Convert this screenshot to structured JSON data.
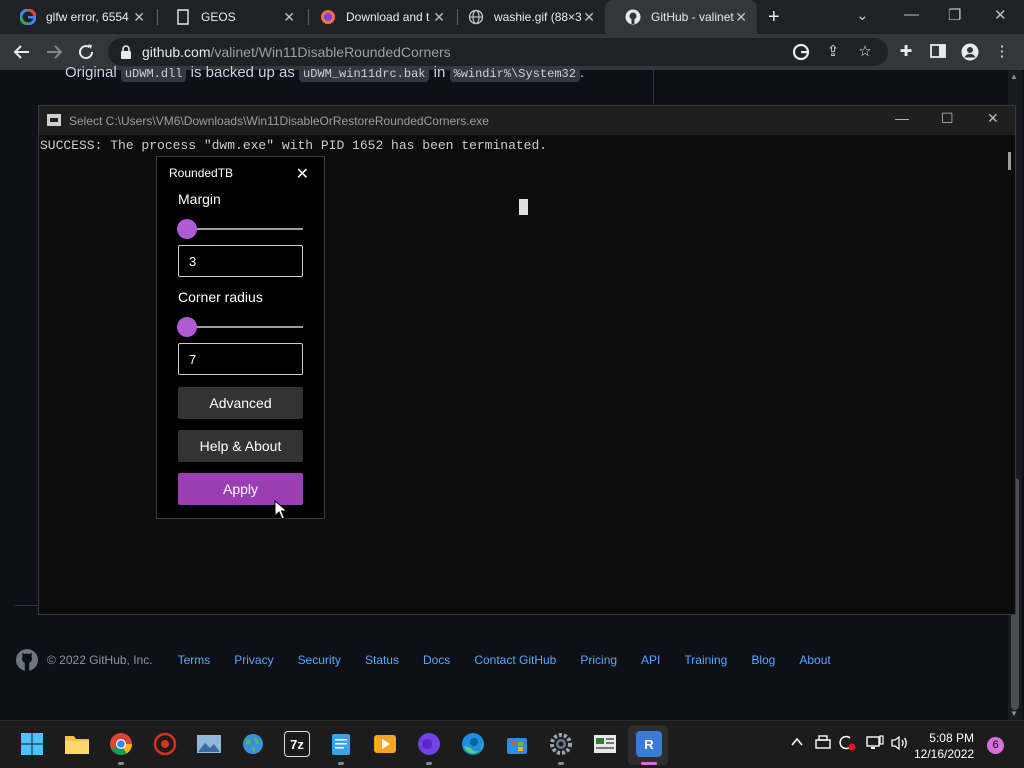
{
  "browser": {
    "tabs": [
      {
        "title": "glfw error, 6554",
        "icon": "google-icon"
      },
      {
        "title": "GEOS",
        "icon": "page-icon"
      },
      {
        "title": "Download and t",
        "icon": "firefox-icon"
      },
      {
        "title": "washie.gif (88×3",
        "icon": "globe-icon"
      },
      {
        "title": "GitHub - valinet",
        "icon": "github-icon"
      }
    ],
    "url_host": "github.com",
    "url_path": "/valinet/Win11DisableRoundedCorners"
  },
  "page": {
    "original_prefix": "Original",
    "original_code1": "uDWM.dll",
    "original_mid": "is backed up as",
    "original_code2": "uDWM_win11drc.bak",
    "original_in": "in",
    "original_code3": "%windir%\\System32",
    "original_end": "."
  },
  "footer": {
    "copyright": "© 2022 GitHub, Inc.",
    "links": [
      "Terms",
      "Privacy",
      "Security",
      "Status",
      "Docs",
      "Contact GitHub",
      "Pricing",
      "API",
      "Training",
      "Blog",
      "About"
    ]
  },
  "console": {
    "title": "Select C:\\Users\\VM6\\Downloads\\Win11DisableOrRestoreRoundedCorners.exe",
    "output": "SUCCESS: The process \"dwm.exe\" with PID 1652 has been terminated."
  },
  "roundedtb": {
    "title": "RoundedTB",
    "margin_label": "Margin",
    "margin_value": "3",
    "margin_slider_level": 0.0,
    "corner_label": "Corner radius",
    "corner_value": "7",
    "corner_slider_level": 0.0,
    "advanced_label": "Advanced",
    "help_label": "Help & About",
    "apply_label": "Apply",
    "accent_color": "#9b3eb4"
  },
  "taskbar": {
    "time": "5:08 PM",
    "date": "12/16/2022",
    "notification_count": "6",
    "apps": [
      "start-icon",
      "file-explorer-icon",
      "chrome-icon",
      "dev-tool-icon",
      "photos-icon",
      "globe-app-icon",
      "7zip-icon",
      "notepad-icon",
      "media-player-icon",
      "firefox-icon",
      "edge-icon",
      "store-icon",
      "settings-icon",
      "sheet-icon",
      "roundedtb-icon"
    ],
    "label_7z": "7z",
    "label_r": "R"
  }
}
